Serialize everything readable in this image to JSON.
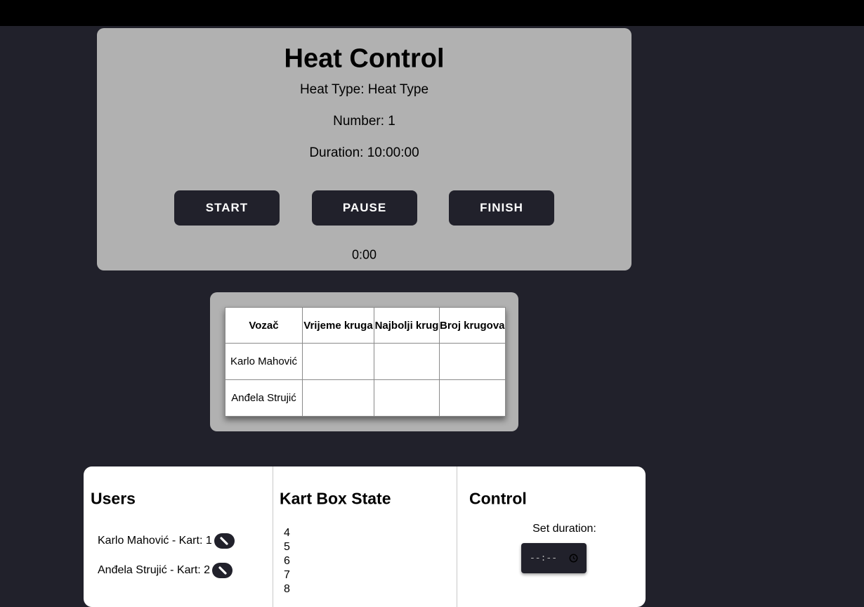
{
  "heat": {
    "title": "Heat Control",
    "type_line": "Heat Type: Heat Type",
    "number_line": "Number: 1",
    "duration_line": "Duration: 10:00:00",
    "buttons": {
      "start": "START",
      "pause": "PAUSE",
      "finish": "FINISH"
    },
    "timer": "0:00"
  },
  "table": {
    "headers": [
      "Vozač",
      "Vrijeme kruga",
      "Najbolji krug",
      "Broj krugova"
    ],
    "rows": [
      [
        "Karlo Mahović",
        "",
        "",
        ""
      ],
      [
        "Anđela Strujić",
        "",
        "",
        ""
      ]
    ]
  },
  "users": {
    "title": "Users",
    "items": [
      "Karlo Mahović - Kart: 1",
      "Anđela Strujić - Kart: 2"
    ]
  },
  "kart_box": {
    "title": "Kart Box State",
    "items": [
      "4",
      "5",
      "6",
      "7",
      "8"
    ]
  },
  "control": {
    "title": "Control",
    "set_duration_label": "Set duration:",
    "duration_input_placeholder": "--:--"
  },
  "icons": {
    "edit": "pencil-icon",
    "clock": "clock-icon"
  },
  "colors": {
    "background": "#21212b",
    "panel": "#b1b1b1",
    "button": "#21212b"
  }
}
